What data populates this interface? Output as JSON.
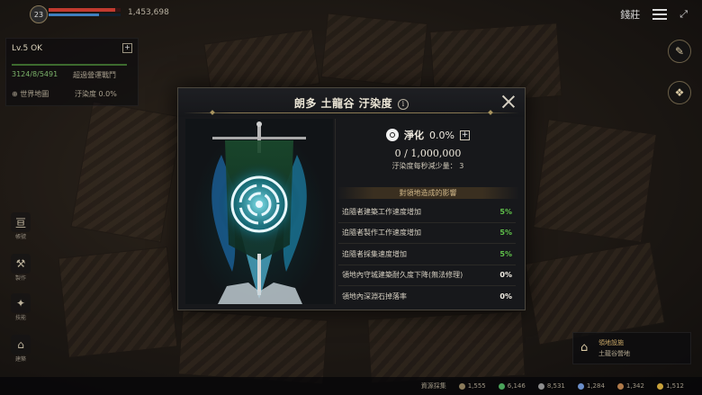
{
  "hud": {
    "level": "23",
    "currency": "1,453,698",
    "top_right_label": "錢莊",
    "status_title": "Lv.5 OK",
    "status_sub": "3124/8/5491",
    "status_sub2": "超過營運戰鬥",
    "world_map": "世界地圖",
    "pollution_short": "汙染度",
    "pollution_short_value": "0.0%"
  },
  "side_nav": [
    {
      "icon": "亘",
      "label": "帳號"
    },
    {
      "icon": "⚒",
      "label": "製作"
    },
    {
      "icon": "✦",
      "label": "技能"
    },
    {
      "icon": "⌂",
      "label": "建築"
    }
  ],
  "right_icons": [
    {
      "icon": "✎",
      "label": "建築編輯"
    },
    {
      "icon": "❖",
      "label": "紀事與成就"
    }
  ],
  "bottom_widget": {
    "title": "領地設施",
    "sub": "土龍谷營地"
  },
  "resources": [
    "資源採集",
    "1,555",
    "6,146",
    "8,531",
    "1,284",
    "1,342",
    "1,512"
  ],
  "modal": {
    "title": "朗多 土龍谷 汙染度",
    "purification_label": "淨化",
    "purification_value": "0.0%",
    "progress": "0 / 1,000,000",
    "reduction_text": "汙染度每秒減少量： 3",
    "effects_header": "對領地造成的影響",
    "effects": [
      {
        "label": "追隨者建築工作速度增加",
        "value": "5%",
        "color": "green"
      },
      {
        "label": "追隨者製作工作速度增加",
        "value": "5%",
        "color": "green"
      },
      {
        "label": "追隨者採集速度增加",
        "value": "5%",
        "color": "green"
      },
      {
        "label": "領地內守城建築耐久度下降(無法修理)",
        "value": "0%",
        "color": "white"
      },
      {
        "label": "領地內深淵石掉落率",
        "value": "0%",
        "color": "white"
      }
    ]
  },
  "colors": {
    "accent_green": "#5fc04a",
    "gold_line": "#8a7a52",
    "banner_glow": "#3fc6e8"
  }
}
